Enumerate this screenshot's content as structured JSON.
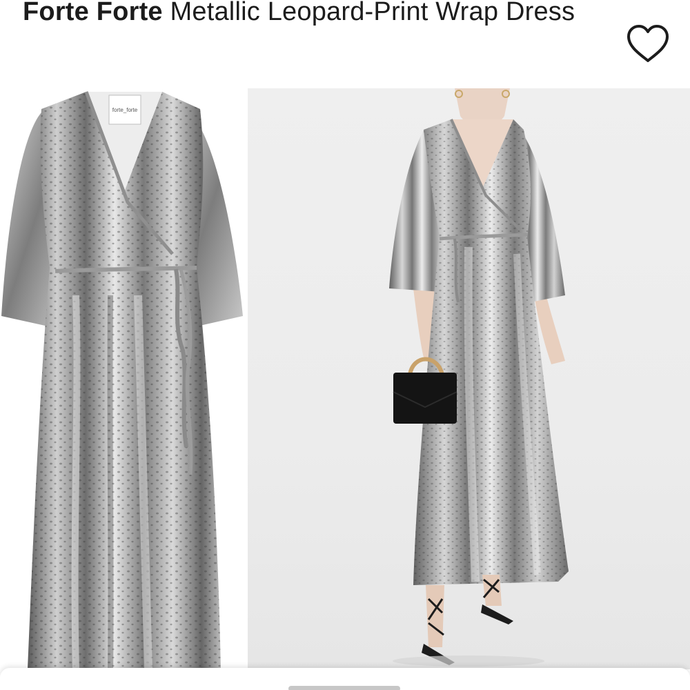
{
  "product": {
    "brand": "Forte Forte",
    "name": "Metallic Leopard-Print Wrap Dress"
  },
  "label": {
    "line1": "forte_forte"
  },
  "icons": {
    "favorite": "heart-outline-icon"
  },
  "colors": {
    "text": "#1c1c1c",
    "silver_light": "#e6e6e6",
    "silver_mid": "#9a9a9a",
    "silver_dark": "#4a4a4a",
    "studio_bg": "#ececec"
  }
}
